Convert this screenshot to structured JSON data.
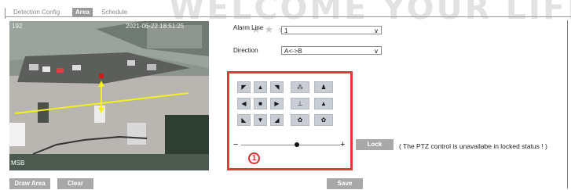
{
  "watermark": "WELCOME YOUR LIFE",
  "stars": "★★★★★",
  "tabs": [
    {
      "label": "Detection Config"
    },
    {
      "label": "Area"
    },
    {
      "label": "Schedule"
    }
  ],
  "video": {
    "osd_left": "192",
    "osd_timestamp": "2021-06-22 18:51:25",
    "osd_bottom": "MSB"
  },
  "form": {
    "alarm_line_label": "Alarm Line",
    "alarm_line_value": "1",
    "direction_label": "Direction",
    "direction_value": "A<->B"
  },
  "ptz": {
    "rows": [
      [
        "◤",
        "▲",
        "◥",
        "⁂",
        "♟"
      ],
      [
        "◀",
        "■",
        "▶",
        "⊥",
        "▲"
      ],
      [
        "◣",
        "▼",
        "◢",
        "✿",
        "✿"
      ]
    ],
    "minus": "−",
    "plus": "+",
    "zoom_level": 0.56,
    "callout": "1"
  },
  "buttons": {
    "lock": "Lock",
    "draw_area": "Draw Area",
    "clear": "Clear",
    "save": "Save"
  },
  "lock_note": "( The PTZ control is unavailabe in locked status ! )",
  "colors": {
    "accent_red": "#e23a3a",
    "button_gray": "#a8a8a8",
    "active_tab": "#9a9a9a"
  }
}
